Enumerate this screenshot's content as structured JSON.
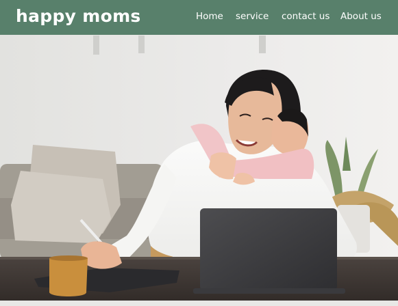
{
  "brand": {
    "name": "happy moms"
  },
  "nav": {
    "items": [
      {
        "label": "Home"
      },
      {
        "label": "service"
      },
      {
        "label": "contact us"
      },
      {
        "label": "About us"
      }
    ]
  },
  "colors": {
    "navbar_bg": "#58806b",
    "nav_text": "#ffffff"
  },
  "hero": {
    "image_description_icon": "mother-with-child-at-laptop-photo"
  }
}
